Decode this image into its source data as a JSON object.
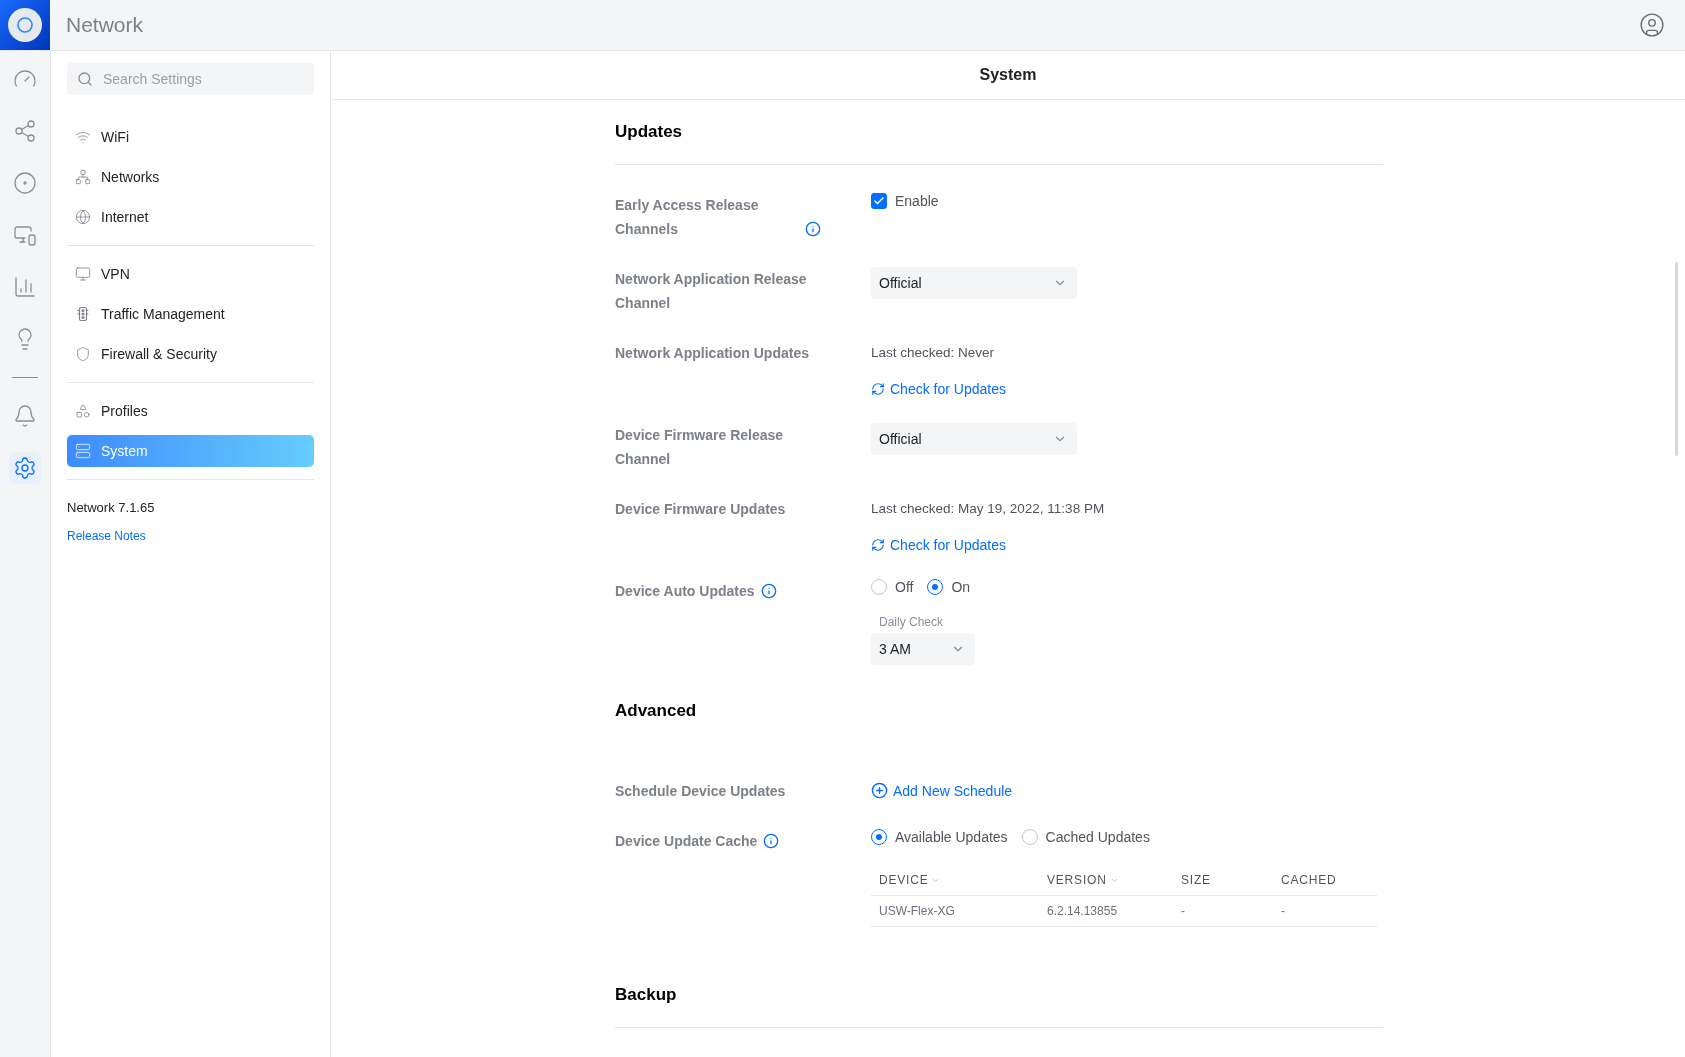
{
  "app": {
    "title": "Network"
  },
  "rail": {
    "top": [
      {
        "selected": false
      },
      {
        "selected": false
      },
      {
        "selected": false
      },
      {
        "selected": false
      },
      {
        "selected": false
      },
      {
        "selected": false
      }
    ],
    "bottom": [
      {
        "selected": false
      },
      {
        "selected": true
      }
    ]
  },
  "search": {
    "placeholder": "Search Settings"
  },
  "sidebar": {
    "groups": [
      [
        {
          "label": "WiFi",
          "selected": false
        },
        {
          "label": "Networks",
          "selected": false
        },
        {
          "label": "Internet",
          "selected": false
        }
      ],
      [
        {
          "label": "VPN",
          "selected": false
        },
        {
          "label": "Traffic Management",
          "selected": false
        },
        {
          "label": "Firewall & Security",
          "selected": false
        }
      ],
      [
        {
          "label": "Profiles",
          "selected": false
        },
        {
          "label": "System",
          "selected": true
        }
      ]
    ],
    "version": "Network 7.1.65",
    "release_notes": "Release Notes"
  },
  "page": {
    "title": "System"
  },
  "sections": [
    {
      "title": "Updates",
      "rule": true,
      "rows": [
        {
          "kind": "checkbox",
          "label": "Early Access Release Channels",
          "info": true,
          "checkbox": {
            "label": "Enable",
            "checked": true
          }
        },
        {
          "kind": "select",
          "label": "Network Application Release Channel",
          "info": false,
          "value": "Official"
        },
        {
          "kind": "check",
          "label": "Network Application Updates",
          "info": false,
          "status": "Last checked: Never",
          "action": "Check for Updates"
        },
        {
          "kind": "select",
          "label": "Device Firmware Release Channel",
          "info": false,
          "value": "Official"
        },
        {
          "kind": "check",
          "label": "Device Firmware Updates",
          "info": false,
          "status": "Last checked: May 19, 2022, 11:38 PM",
          "action": "Check for Updates"
        },
        {
          "kind": "radio",
          "label": "Device Auto Updates",
          "info": true,
          "options": [
            {
              "label": "Off",
              "selected": false
            },
            {
              "label": "On",
              "selected": true
            }
          ],
          "sub_select": {
            "label": "Daily Check",
            "value": "3 AM"
          }
        }
      ]
    },
    {
      "title": "Advanced",
      "rule": false,
      "rows": [
        {
          "kind": "link",
          "label": "Schedule Device Updates",
          "info": false,
          "action": "Add New Schedule"
        },
        {
          "kind": "radio_table",
          "label": "Device Update Cache",
          "info": true,
          "options": [
            {
              "label": "Available Updates",
              "selected": true
            },
            {
              "label": "Cached Updates",
              "selected": false
            }
          ],
          "table": {
            "columns": [
              {
                "label": "DEVICE",
                "sortable": true
              },
              {
                "label": "VERSION",
                "sortable": true
              },
              {
                "label": "SIZE",
                "sortable": false
              },
              {
                "label": "CACHED",
                "sortable": false
              }
            ],
            "rows": [
              [
                "USW-Flex-XG",
                "6.2.14.13855",
                "-",
                "-"
              ]
            ]
          }
        }
      ]
    },
    {
      "title": "Backup",
      "rule": true
    }
  ]
}
